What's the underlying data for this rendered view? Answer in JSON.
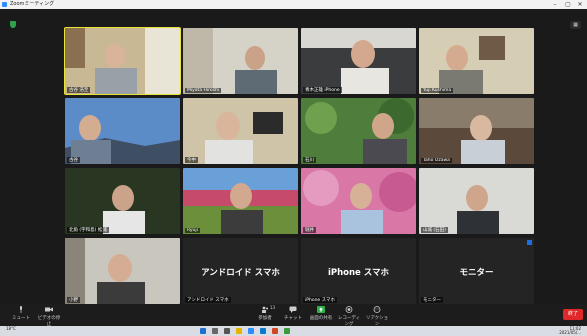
{
  "window": {
    "title": "Zoomミーティング"
  },
  "meeting": {
    "participants": [
      {
        "name": "古谷 浩至"
      },
      {
        "name": "Miyata Hiroshi"
      },
      {
        "name": "青木正雄 iPhone"
      },
      {
        "name": "Yuji Kushima"
      },
      {
        "name": "古谷"
      },
      {
        "name": "今中"
      },
      {
        "name": "石川"
      },
      {
        "name": "Taho Ozawa"
      },
      {
        "name": "北角 (宇和島) 松浦"
      },
      {
        "name": "Ryuji"
      },
      {
        "name": "堀井"
      },
      {
        "name": "山城 (石田)"
      },
      {
        "name": "小野"
      }
    ],
    "device_tiles": [
      {
        "big_label": "アンドロイド スマホ",
        "tag": "アンドロイド スマホ"
      },
      {
        "big_label": "iPhone スマホ",
        "tag": "iPhone スマホ"
      },
      {
        "big_label": "モニター",
        "tag": "モニター"
      }
    ]
  },
  "toolbar": {
    "mute": "ミュート",
    "video": "ビデオの停止",
    "participants": "参加者",
    "participant_count": "13",
    "chat": "チャット",
    "share": "画面の共有",
    "record": "レコーディング",
    "reactions": "リアクション",
    "end": "終了"
  },
  "colors": {
    "accent_border": "#e8e335",
    "end_red": "#e02828",
    "shield_green": "#2fa24a"
  },
  "taskbar": {
    "weather": "18°C",
    "time": "11:02",
    "date": "2021/05/..."
  }
}
